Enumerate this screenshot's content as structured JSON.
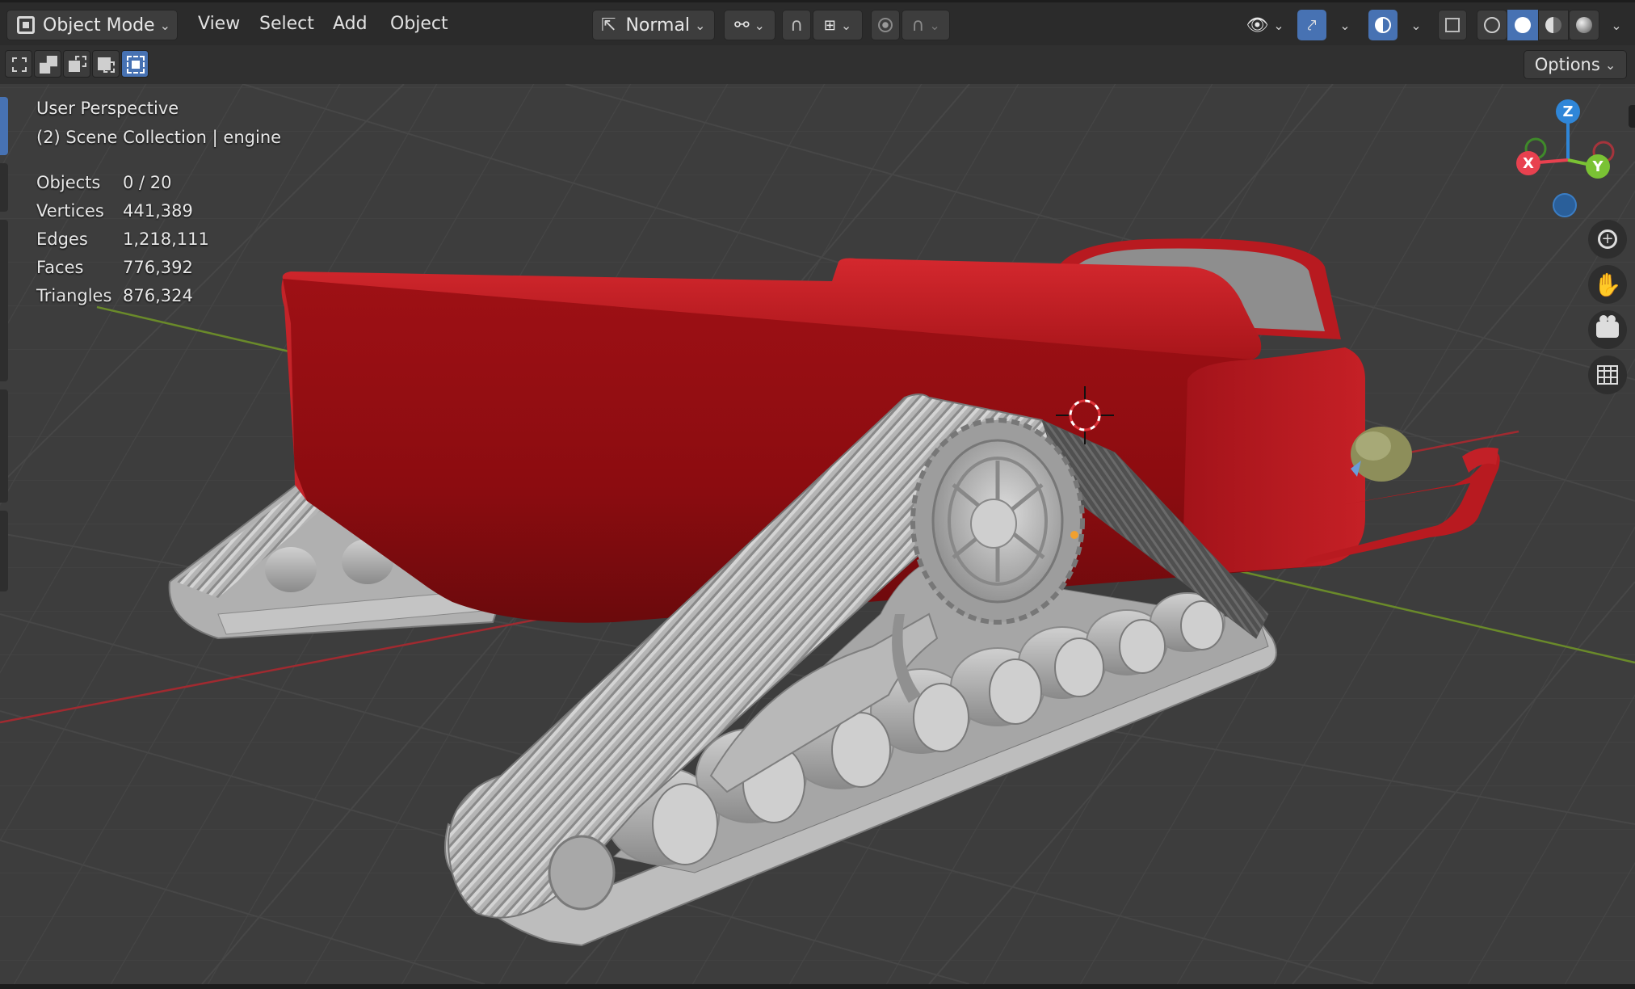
{
  "header": {
    "mode_label": "Object Mode",
    "menus": [
      "View",
      "Select",
      "Add",
      "Object"
    ],
    "orientation_label": "Normal"
  },
  "toolbar": {
    "options_label": "Options"
  },
  "viewport": {
    "view_name": "User Perspective",
    "collection_info": "(2) Scene Collection | engine",
    "stats": [
      {
        "label": "Objects",
        "value": "0 / 20"
      },
      {
        "label": "Vertices",
        "value": "441,389"
      },
      {
        "label": "Edges",
        "value": "1,218,111"
      },
      {
        "label": "Faces",
        "value": "776,392"
      },
      {
        "label": "Triangles",
        "value": "876,324"
      }
    ]
  },
  "gizmo": {
    "x_label": "X",
    "y_label": "Y",
    "z_label": "Z",
    "x_color": "#e8414f",
    "y_color": "#7ac234",
    "z_color": "#2f86d8"
  },
  "colors": {
    "accent": "#4772b3",
    "body_red": "#b5161c",
    "track_gray": "#b8b8b8"
  }
}
